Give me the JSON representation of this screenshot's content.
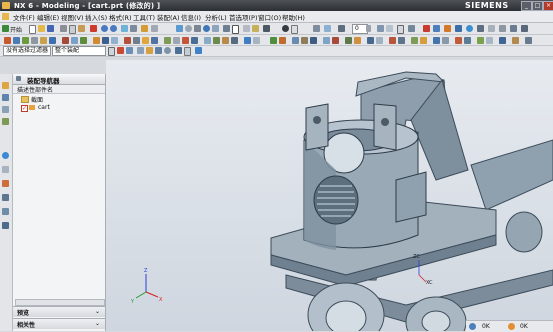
{
  "window": {
    "title": "NX 6 - Modeling - [cart.prt  (修改的) ]",
    "brand": "SIEMENS",
    "controls": [
      "_",
      "□",
      "×"
    ]
  },
  "menu": [
    "文件(F)",
    "编辑(E)",
    "视图(V)",
    "插入(S)",
    "格式(R)",
    "工具(T)",
    "装配(A)",
    "信息(I)",
    "分析(L)",
    "首选项(P)",
    "窗口(O)",
    "帮助(H)"
  ],
  "toolbar": {
    "start_label": "开始",
    "zoom_value": "0"
  },
  "selection_bar": {
    "filter_value": "没有选择过滤器",
    "scope_value": "整个装配"
  },
  "assembly_navigator": {
    "title": "装配导航器",
    "column_header": "描述性部件名",
    "items": [
      {
        "label": "截面",
        "type": "folder"
      },
      {
        "label": "cart",
        "type": "part",
        "checked": true
      }
    ],
    "bottom_panels": [
      "预览",
      "相关性"
    ]
  },
  "viewport": {
    "axis_labels": {
      "x": "X",
      "y": "Y",
      "z": "Z"
    },
    "part_axis_labels": {
      "x": "XC",
      "y": "YC",
      "z": "ZC"
    }
  },
  "taskbar": {
    "items": [
      "0K",
      "0K"
    ]
  },
  "colors": {
    "title_bar": "#2b2e33",
    "part_fill": "#9aa9b6",
    "part_dark": "#6f8190",
    "selection_orange": "#e8922b",
    "axis_x": "#d62020",
    "axis_y": "#1f9b2a",
    "axis_z": "#2a3fd6"
  }
}
